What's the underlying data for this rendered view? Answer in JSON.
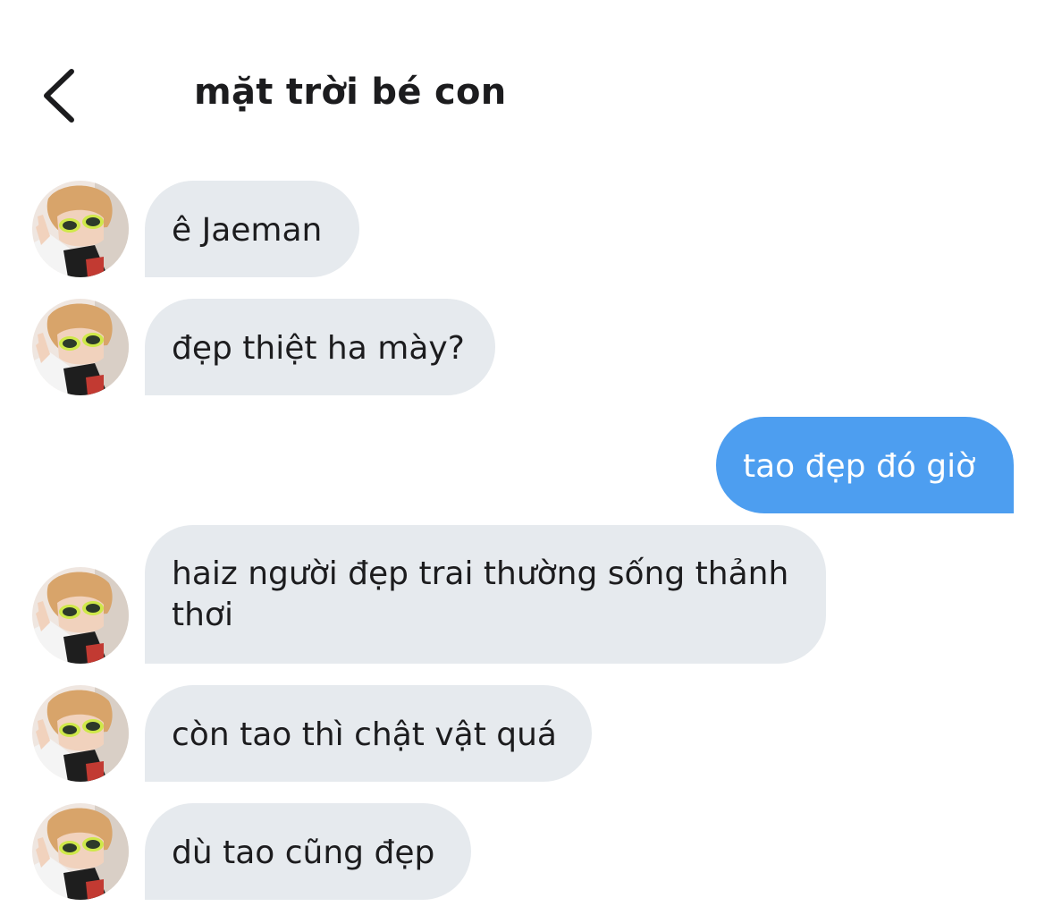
{
  "header": {
    "title": "mặt trời bé con",
    "back_icon": "chevron-left-icon"
  },
  "colors": {
    "incoming_bubble": "#e6eaee",
    "outgoing_bubble": "#4d9ef0",
    "text": "#1c1c1e"
  },
  "messages": [
    {
      "direction": "incoming",
      "text": "ê Jaeman"
    },
    {
      "direction": "incoming",
      "text": "đẹp thiệt ha mày?"
    },
    {
      "direction": "outgoing",
      "text": "tao đẹp đó giờ"
    },
    {
      "direction": "incoming",
      "text": "haiz người đẹp trai thường sống thảnh thơi"
    },
    {
      "direction": "incoming",
      "text": "còn tao thì chật vật quá"
    },
    {
      "direction": "incoming",
      "text": "dù tao cũng đẹp"
    }
  ]
}
